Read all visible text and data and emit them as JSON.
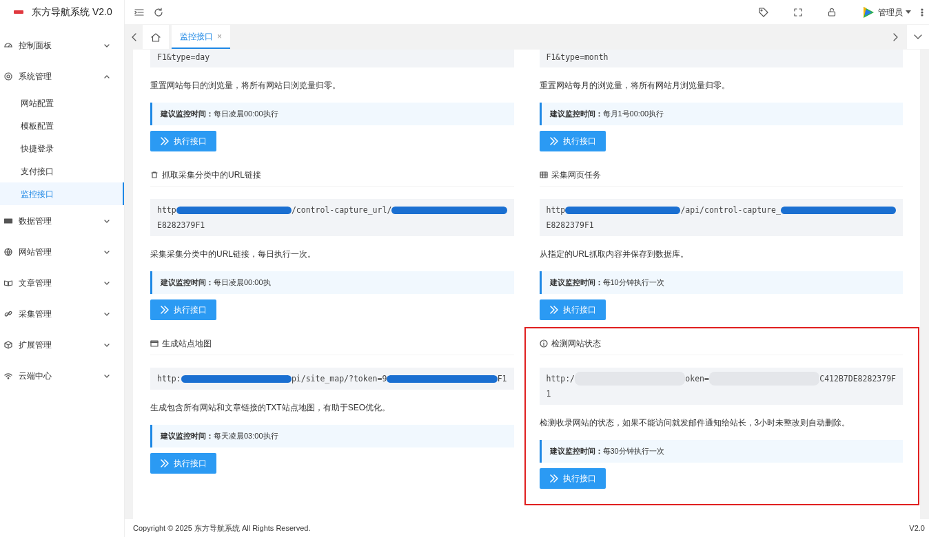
{
  "app": {
    "logo_text": "东方导航系统 V2.0"
  },
  "sidebar": {
    "items": [
      {
        "label": "控制面板",
        "expanded": false,
        "selected": false
      },
      {
        "label": "系统管理",
        "expanded": true,
        "selected": false,
        "children": [
          {
            "label": "网站配置",
            "selected": false
          },
          {
            "label": "模板配置",
            "selected": false
          },
          {
            "label": "快捷登录",
            "selected": false
          },
          {
            "label": "支付接口",
            "selected": false
          },
          {
            "label": "监控接口",
            "selected": true
          }
        ]
      },
      {
        "label": "数据管理",
        "expanded": false,
        "selected": false
      },
      {
        "label": "网站管理",
        "expanded": false,
        "selected": false
      },
      {
        "label": "文章管理",
        "expanded": false,
        "selected": false
      },
      {
        "label": "采集管理",
        "expanded": false,
        "selected": false
      },
      {
        "label": "扩展管理",
        "expanded": false,
        "selected": false
      },
      {
        "label": "云端中心",
        "expanded": false,
        "selected": false
      }
    ]
  },
  "header": {
    "user": "管理员"
  },
  "tabs": [
    {
      "kind": "home",
      "selected": false
    },
    {
      "kind": "page",
      "label": "监控接口",
      "close": "×",
      "selected": true
    }
  ],
  "cards": [
    {
      "url_lines": [
        [
          {
            "kind": "text",
            "text": "F1&type=day"
          }
        ]
      ],
      "description": "重置网站每日的浏览量，将所有网站日浏览量归零。",
      "note_label": "建议监控时间：",
      "note_value": "每日凌晨00:00执行",
      "button": "执行接口",
      "highlighted": false
    },
    {
      "url_lines": [
        [
          {
            "kind": "text",
            "text": "F1&type=month"
          }
        ]
      ],
      "description": "重置网站每月的浏览量，将所有网站月浏览量归零。",
      "note_label": "建议监控时间：",
      "note_value": "每月1号00:00执行",
      "button": "执行接口",
      "highlighted": false
    },
    {
      "title": "抓取采集分类中的URL链接",
      "url_lines": [
        [
          {
            "kind": "text",
            "text": "http"
          },
          {
            "kind": "scribble"
          },
          {
            "kind": "text",
            "text": "/control-capture_url/"
          },
          {
            "kind": "scribble"
          }
        ],
        [
          {
            "kind": "text",
            "text": "E8282379F1"
          }
        ]
      ],
      "description": "采集采集分类中的URL链接，每日执行一次。",
      "note_label": "建议监控时间：",
      "note_value": "每日凌晨00:00执",
      "button": "执行接口",
      "highlighted": false
    },
    {
      "title": "采集网页任务",
      "url_lines": [
        [
          {
            "kind": "text",
            "text": "http"
          },
          {
            "kind": "scribble"
          },
          {
            "kind": "text",
            "text": "/api/control-capture_"
          },
          {
            "kind": "scribble"
          }
        ],
        [
          {
            "kind": "text",
            "text": "E8282379F1"
          }
        ]
      ],
      "description": "从指定的URL抓取内容并保存到数据库。",
      "note_label": "建议监控时间：",
      "note_value": "每10分钟执行一次",
      "button": "执行接口",
      "highlighted": false
    },
    {
      "title": "生成站点地图",
      "url_lines": [
        [
          {
            "kind": "text",
            "text": "http:"
          },
          {
            "kind": "scribble"
          },
          {
            "kind": "text",
            "text": "pi/site_map/?token=9"
          },
          {
            "kind": "scribble"
          },
          {
            "kind": "text",
            "text": "F1"
          }
        ]
      ],
      "description": "生成包含所有网站和文章链接的TXT站点地图，有助于SEO优化。",
      "note_label": "建议监控时间：",
      "note_value": "每天凌晨03:00执行",
      "button": "执行接口",
      "highlighted": false
    },
    {
      "title": "检测网站状态",
      "url_lines": [
        [
          {
            "kind": "text",
            "text": "http:/"
          },
          {
            "kind": "blur"
          },
          {
            "kind": "text",
            "text": "oken="
          },
          {
            "kind": "blur"
          },
          {
            "kind": "text",
            "text": "C412B7DE8282379F"
          }
        ],
        [
          {
            "kind": "text",
            "text": "1"
          }
        ]
      ],
      "description": "检测收录网站的状态，如果不能访问就发邮件通知给站长，3小时未整改则自动删除。",
      "note_label": "建议监控时间：",
      "note_value": "每30分钟执行一次",
      "button": "执行接口",
      "highlighted": true
    }
  ],
  "footer": {
    "copyright": "Copyright © 2025 东方导航系统 All Rights Reserved.",
    "version": "V2.0"
  }
}
